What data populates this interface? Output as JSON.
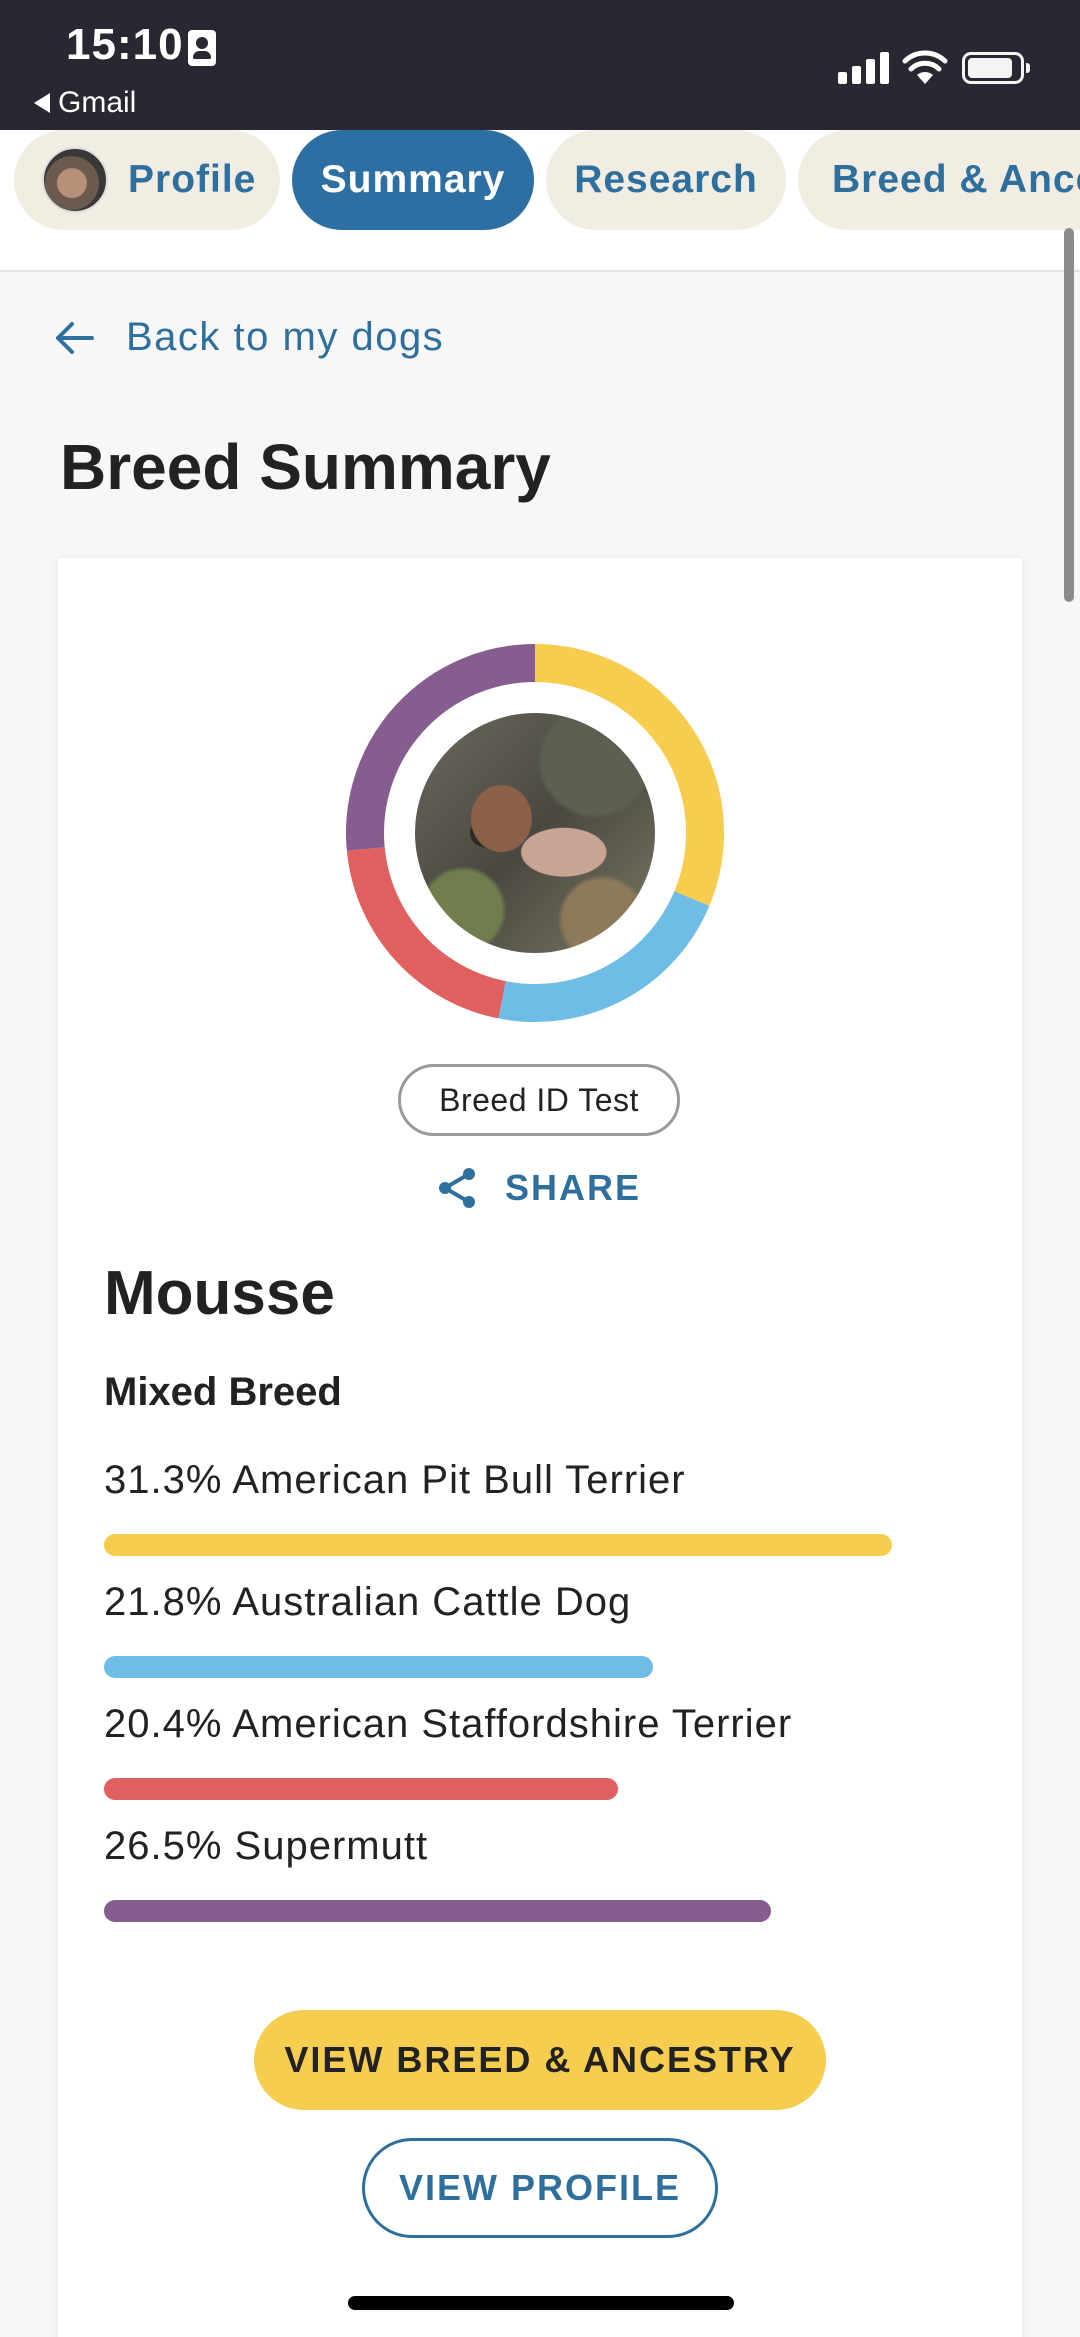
{
  "status_bar": {
    "time": "15:10",
    "back_app": "Gmail"
  },
  "tabs": [
    {
      "label": "Profile",
      "active": false,
      "has_avatar": true
    },
    {
      "label": "Summary",
      "active": true
    },
    {
      "label": "Research",
      "active": false
    },
    {
      "label": "Breed & Ancestry",
      "active": false
    }
  ],
  "back_link": "Back to my dogs",
  "page_title": "Breed Summary",
  "card": {
    "test_badge": "Breed ID Test",
    "share_label": "SHARE",
    "dog_name": "Mousse",
    "breed_type": "Mixed Breed",
    "breeds": [
      {
        "label": "31.3% American Pit Bull Terrier",
        "percent": 31.3,
        "color": "#f6cd4e"
      },
      {
        "label": "21.8% Australian Cattle Dog",
        "percent": 21.8,
        "color": "#6fbde6"
      },
      {
        "label": "20.4% American Staffordshire Terrier",
        "percent": 20.4,
        "color": "#e0605f"
      },
      {
        "label": "26.5% Supermutt",
        "percent": 26.5,
        "color": "#855d8f"
      }
    ],
    "primary_button": "VIEW BREED & ANCESTRY",
    "secondary_button": "VIEW PROFILE"
  },
  "colors": {
    "brand_blue": "#2d6fa3",
    "link_blue": "#2e6f9e",
    "tab_bg": "#f2ede2",
    "status_bar_bg": "#282732"
  }
}
